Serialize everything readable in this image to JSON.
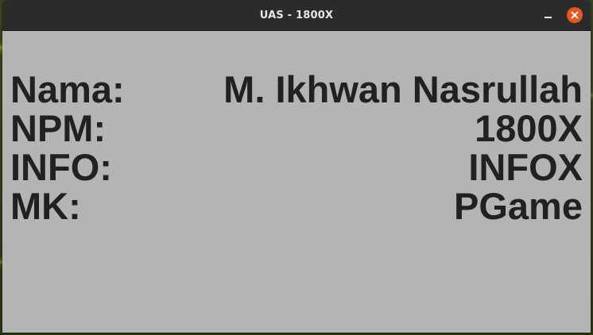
{
  "window": {
    "title": "UAS - 1800X",
    "controls": {
      "minimize_icon": "minimize-icon",
      "close_icon": "close-icon",
      "close_color": "#e9541f"
    }
  },
  "info": {
    "rows": [
      {
        "label": "Nama:",
        "value": "M. Ikhwan Nasrullah"
      },
      {
        "label": "NPM:",
        "value": "1800X"
      },
      {
        "label": "INFO:",
        "value": "INFOX"
      },
      {
        "label": "MK:",
        "value": "PGame"
      }
    ]
  },
  "colors": {
    "window_background": "#b4b4b4",
    "titlebar_background": "#2b2b2b",
    "text": "#212121"
  }
}
